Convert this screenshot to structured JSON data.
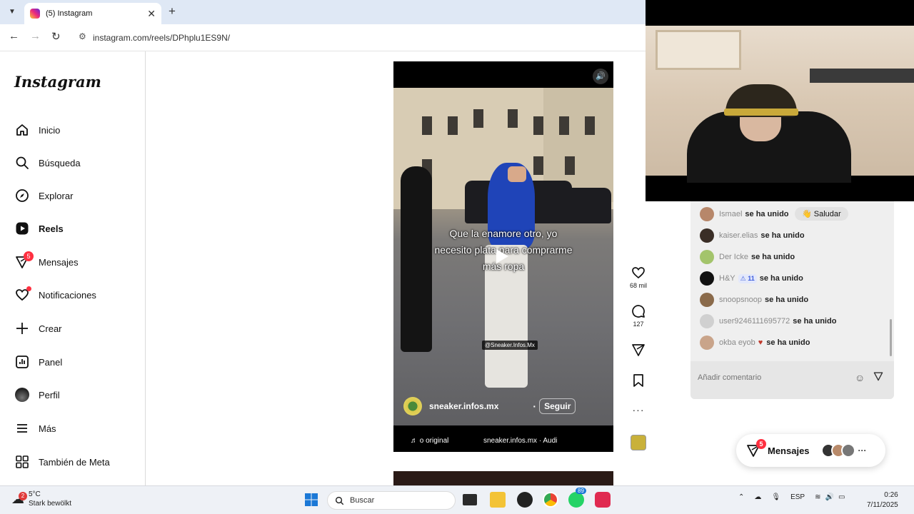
{
  "browser": {
    "tab_title": "(5) Instagram",
    "url": "instagram.com/reels/DPhplu1ES9N/"
  },
  "sidebar": {
    "logo": "Instagram",
    "items": [
      {
        "label": "Inicio",
        "icon": "home-icon"
      },
      {
        "label": "Búsqueda",
        "icon": "search-icon"
      },
      {
        "label": "Explorar",
        "icon": "compass-icon"
      },
      {
        "label": "Reels",
        "icon": "reels-icon"
      },
      {
        "label": "Mensajes",
        "icon": "messenger-icon",
        "badge": "5"
      },
      {
        "label": "Notificaciones",
        "icon": "heart-icon"
      },
      {
        "label": "Crear",
        "icon": "plus-icon"
      },
      {
        "label": "Panel",
        "icon": "chart-icon"
      },
      {
        "label": "Perfil",
        "icon": "avatar"
      },
      {
        "label": "Más",
        "icon": "hamburger-icon"
      },
      {
        "label": "También de Meta",
        "icon": "meta-apps-icon"
      }
    ]
  },
  "reel": {
    "caption_line1": "Que la enamore otro, yo",
    "caption_line2": "necesito plata para comprarme",
    "caption_line3": "más ropa",
    "watermark": "@Sneaker.Infos.Mx",
    "author": "sneaker.infos.mx",
    "follow_label": "Seguir",
    "audio_left": "♬ o original",
    "audio_right": "sneaker.infos.mx · Audi"
  },
  "actions": {
    "likes": "68 mil",
    "comments": "127"
  },
  "chat": {
    "rows": [
      {
        "user": "Ismael",
        "text": "se ha unido",
        "color": "#b7876a"
      },
      {
        "user": "kaiser.elias",
        "text": "se ha unido",
        "color": "#3a2e26"
      },
      {
        "user": "Der Icke",
        "text": "se ha unido",
        "color": "#a3c46b"
      },
      {
        "user": "H&Y",
        "tag": "⚠ 11",
        "text": "se ha unido",
        "color": "#111111"
      },
      {
        "user": "snoopsnoop",
        "text": "se ha unido",
        "color": "#8a6a4a"
      },
      {
        "user": "user9246111695772",
        "text": "se ha unido",
        "color": "#d0d0d0"
      },
      {
        "user": "okba eyob",
        "emoji": "♥",
        "text": "se ha unido",
        "color": "#c9a48a"
      }
    ],
    "saludar_label": "Saludar",
    "comment_placeholder": "Añadir comentario"
  },
  "messages_pill": {
    "label": "Mensajes",
    "badge": "5"
  },
  "taskbar": {
    "temp": "5°C",
    "weather_desc": "Stark bewölkt",
    "weather_badge": "2",
    "search_placeholder": "Buscar",
    "whatsapp_badge": "89",
    "lang": "ESP",
    "time": "0:26",
    "date": "7/11/2025"
  }
}
